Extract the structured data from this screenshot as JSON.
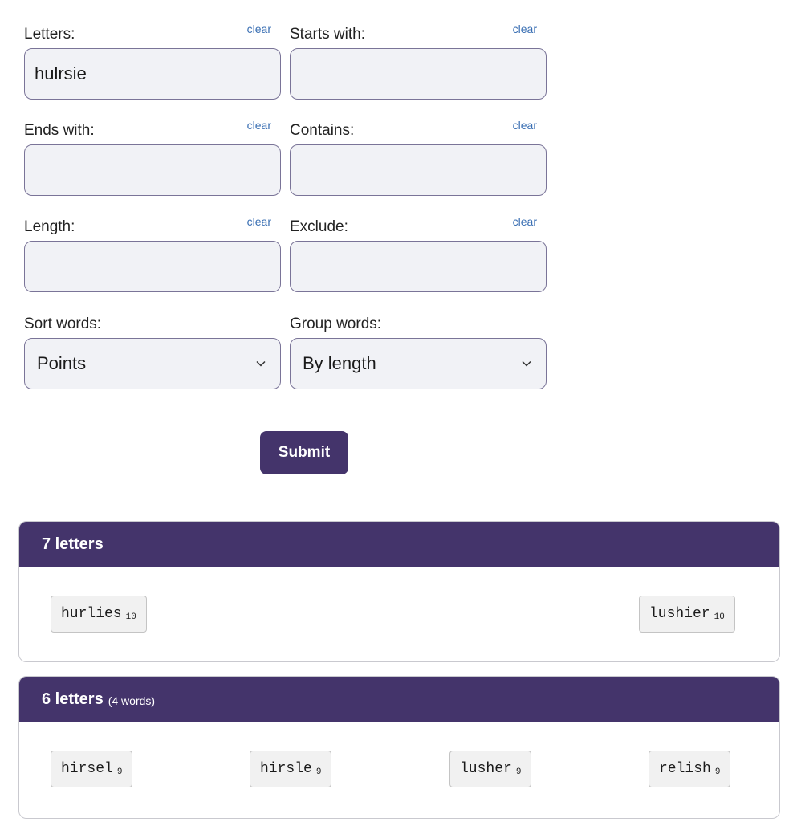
{
  "form": {
    "letters": {
      "label": "Letters:",
      "value": "hulrsie",
      "clear": "clear"
    },
    "starts_with": {
      "label": "Starts with:",
      "value": "",
      "clear": "clear"
    },
    "ends_with": {
      "label": "Ends with:",
      "value": "",
      "clear": "clear"
    },
    "contains": {
      "label": "Contains:",
      "value": "",
      "clear": "clear"
    },
    "length": {
      "label": "Length:",
      "value": "",
      "clear": "clear"
    },
    "exclude": {
      "label": "Exclude:",
      "value": "",
      "clear": "clear"
    },
    "sort": {
      "label": "Sort words:",
      "selected": "Points"
    },
    "group": {
      "label": "Group words:",
      "selected": "By length"
    },
    "submit": "Submit"
  },
  "results": [
    {
      "title": "7 letters",
      "count": "",
      "words": [
        {
          "word": "hurlies",
          "points": "10"
        },
        {
          "word": "lushier",
          "points": "10"
        }
      ]
    },
    {
      "title": "6 letters",
      "count": "(4 words)",
      "words": [
        {
          "word": "hirsel",
          "points": "9"
        },
        {
          "word": "hirsle",
          "points": "9"
        },
        {
          "word": "lusher",
          "points": "9"
        },
        {
          "word": "relish",
          "points": "9"
        }
      ]
    }
  ],
  "colors": {
    "accent": "#44346b",
    "link": "#3a6fb3",
    "input_bg": "#f1f2f6"
  }
}
